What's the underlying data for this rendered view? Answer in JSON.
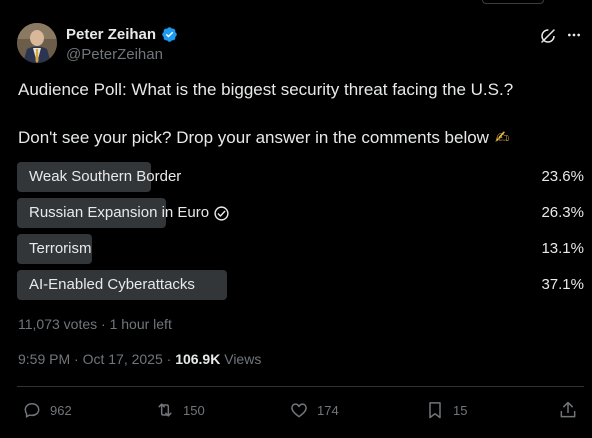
{
  "author": {
    "name": "Peter Zeihan",
    "handle": "@PeterZeihan",
    "verified_color": "#1d9bf0"
  },
  "post": {
    "line1": "Audience Poll: What is the biggest security threat facing the U.S.?",
    "line2": "Don't see your pick? Drop your answer in the comments below",
    "emoji": "✍"
  },
  "poll": {
    "options": [
      {
        "label": "Weak Southern Border",
        "percent_label": "23.6%",
        "percent": 23.6,
        "voted": false
      },
      {
        "label": "Russian Expansion in Euro",
        "percent_label": "26.3%",
        "percent": 26.3,
        "voted": true
      },
      {
        "label": "Terrorism",
        "percent_label": "13.1%",
        "percent": 13.1,
        "voted": false
      },
      {
        "label": "AI-Enabled Cyberattacks",
        "percent_label": "37.1%",
        "percent": 37.1,
        "voted": false
      }
    ],
    "meta": "11,073 votes · 1 hour left"
  },
  "timestamp": {
    "time_date": "9:59 PM · Oct 17, 2025 · ",
    "views_count": "106.9K",
    "views_label": " Views"
  },
  "actions": {
    "replies": "962",
    "reposts": "150",
    "likes": "174",
    "bookmarks": "15"
  },
  "colors": {
    "background": "#000000",
    "text": "#e7e9ea",
    "muted": "#71767b",
    "poll_bar": "#333639",
    "accent": "#1d9bf0"
  },
  "icons": [
    "verified-badge-icon",
    "grok-icon",
    "more-icon",
    "check-circle-icon",
    "reply-icon",
    "repost-icon",
    "like-icon",
    "bookmark-icon",
    "share-icon"
  ]
}
